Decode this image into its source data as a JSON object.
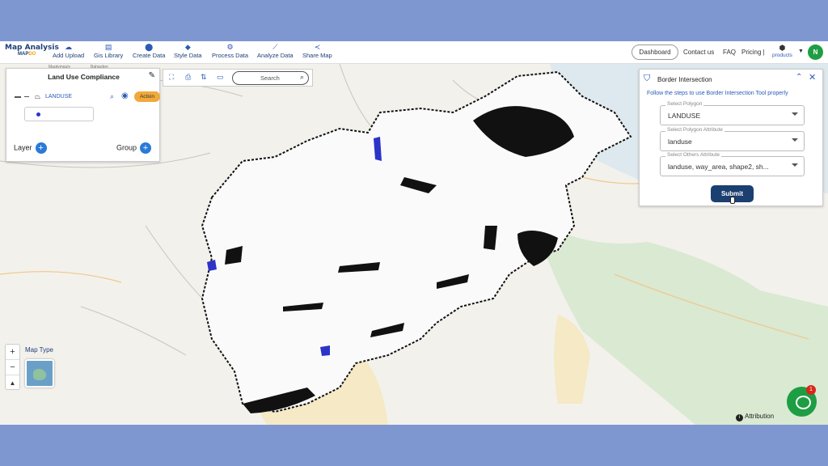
{
  "app": {
    "logo_line1": "Map Analysis",
    "logo_line2_a": "MAP",
    "logo_line2_b": "DO"
  },
  "toolbar": [
    {
      "label": "Add Upload",
      "icon": "cloud-upload-icon"
    },
    {
      "label": "Gis Library",
      "icon": "library-icon"
    },
    {
      "label": "Create Data",
      "icon": "pin-icon"
    },
    {
      "label": "Style Data",
      "icon": "paint-icon"
    },
    {
      "label": "Process Data",
      "icon": "process-icon"
    },
    {
      "label": "Analyze Data",
      "icon": "analyze-icon"
    },
    {
      "label": "Share Map",
      "icon": "share-icon"
    }
  ],
  "nav": {
    "dashboard": "Dashboard",
    "contact": "Contact us",
    "faq": "FAQ",
    "pricing": "Pricing |",
    "products": "products",
    "avatar": "N"
  },
  "layer_panel": {
    "title": "Land Use Compliance",
    "layer_name": "LANDUSE",
    "action": "Action",
    "layer_label": "Layer",
    "group_label": "Group",
    "legend_color": "#2c33c8"
  },
  "map_toolbar": {
    "search_placeholder": "Search"
  },
  "border_panel": {
    "title": "Border Intersection",
    "help": "Follow the steps to use Border Intersection Tool properly",
    "fields": [
      {
        "label": "Select Polygon",
        "value": "LANDUSE"
      },
      {
        "label": "Select Polygon Attribute",
        "value": "landuse"
      },
      {
        "label": "Select Others Attribute",
        "value": "landuse, way_area, shape2, sh..."
      }
    ],
    "submit": "Submit"
  },
  "map_controls": {
    "zoom_in": "+",
    "zoom_out": "−",
    "map_type": "Map Type",
    "attribution": "Attribution",
    "chat_badge": "1"
  },
  "colors": {
    "brand": "#1f3f77",
    "accent": "#2a5bb8",
    "action": "#f1a93b",
    "submit": "#1b3f70",
    "chat": "#1e9e43"
  }
}
